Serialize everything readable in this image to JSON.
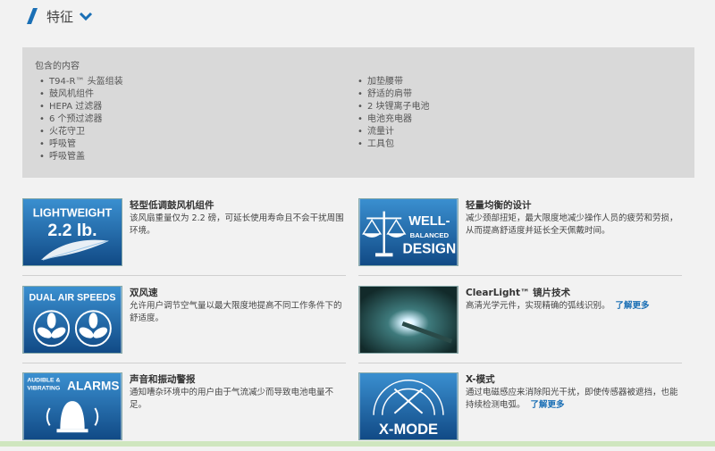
{
  "header": {
    "title": "特征"
  },
  "contents": {
    "label": "包含的内容",
    "left": [
      "T94-R™ 头盔组装",
      "鼓风机组件",
      "HEPA 过滤器",
      "6 个预过滤器",
      "火花守卫",
      "呼吸管",
      "呼吸管盖"
    ],
    "right": [
      "加垫腰带",
      "舒适的肩带",
      "2 块锂离子电池",
      "电池充电器",
      "流量计",
      "工具包"
    ]
  },
  "features": [
    {
      "title": "轻型低调鼓风机组件",
      "desc": "该风扇重量仅为 2.2 磅，可延长使用寿命且不会干扰周围环境。",
      "icon_text_1": "LIGHTWEIGHT",
      "icon_text_2": "2.2 lb.",
      "icon": "feather-icon"
    },
    {
      "title": "轻量均衡的设计",
      "desc": "减少颈部扭矩，最大限度地减少操作人员的疲劳和劳损，从而提高舒适度并延长全天佩戴时间。",
      "icon_text_1": "WELL-",
      "icon_text_2": "BALANCED",
      "icon_text_3": "DESIGN",
      "icon": "scale-icon"
    },
    {
      "title": "双风速",
      "desc": "允许用户调节空气量以最大限度地提高不同工作条件下的舒适度。",
      "icon_text_1": "DUAL AIR SPEEDS",
      "icon": "fan-icon"
    },
    {
      "title": "ClearLight™ 镜片技术",
      "desc": "高清光学元件，实现精确的弧线识别。",
      "learn_more": "了解更多",
      "icon": "welding-arc-photo"
    },
    {
      "title": "声音和振动警报",
      "desc": "通知嘈杂环境中的用户由于气流减少而导致电池电量不足。",
      "icon_text_1": "AUDIBLE &",
      "icon_text_2": "VIBRATING",
      "icon_text_3": "ALARMS",
      "icon": "bell-icon"
    },
    {
      "title": "X-模式",
      "desc": "通过电磁感应来消除阳光干扰，即使传感器被遮挡，也能持续检测电弧。",
      "learn_more": "了解更多",
      "icon_text_1": "X-MODE",
      "icon": "xmode-icon"
    }
  ],
  "colors": {
    "accent": "#1a6fb5",
    "icon_blue": "#1a5fa2",
    "panel": "#d9d9d9"
  }
}
